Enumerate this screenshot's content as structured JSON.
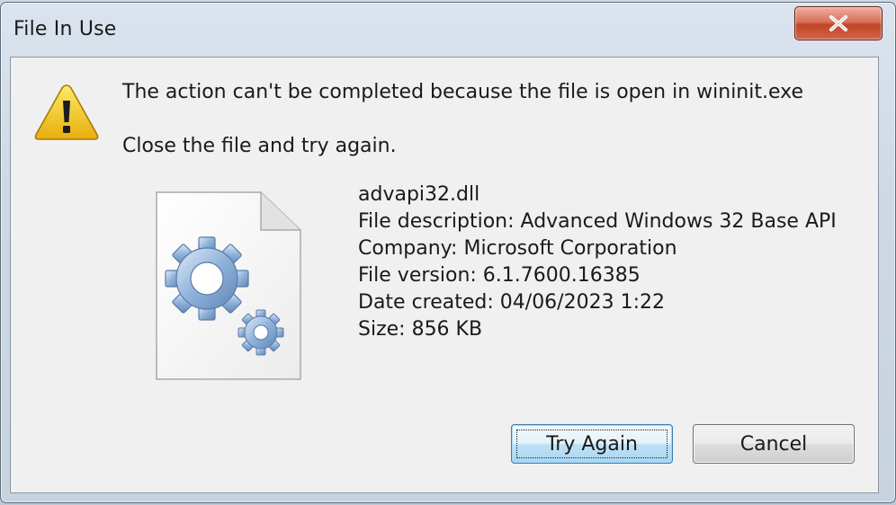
{
  "dialog": {
    "title": "File In Use",
    "message": "The action can't be completed because the file is open in wininit.exe",
    "hint": "Close the file and try again."
  },
  "file": {
    "name": "advapi32.dll",
    "description": "File description: Advanced Windows 32 Base API",
    "company": "Company: Microsoft Corporation",
    "version": "File version: 6.1.7600.16385",
    "date_created": "Date created: 04/06/2023 1:22",
    "size": "Size: 856 KB"
  },
  "buttons": {
    "try_again": "Try Again",
    "cancel": "Cancel"
  },
  "icons": {
    "warning": "warning-icon",
    "file": "dll-file-gears-icon",
    "close": "close-icon"
  },
  "colors": {
    "close_button": "#c94a2e",
    "default_button_border": "#3c7fb1",
    "warning_yellow": "#f2c418"
  }
}
